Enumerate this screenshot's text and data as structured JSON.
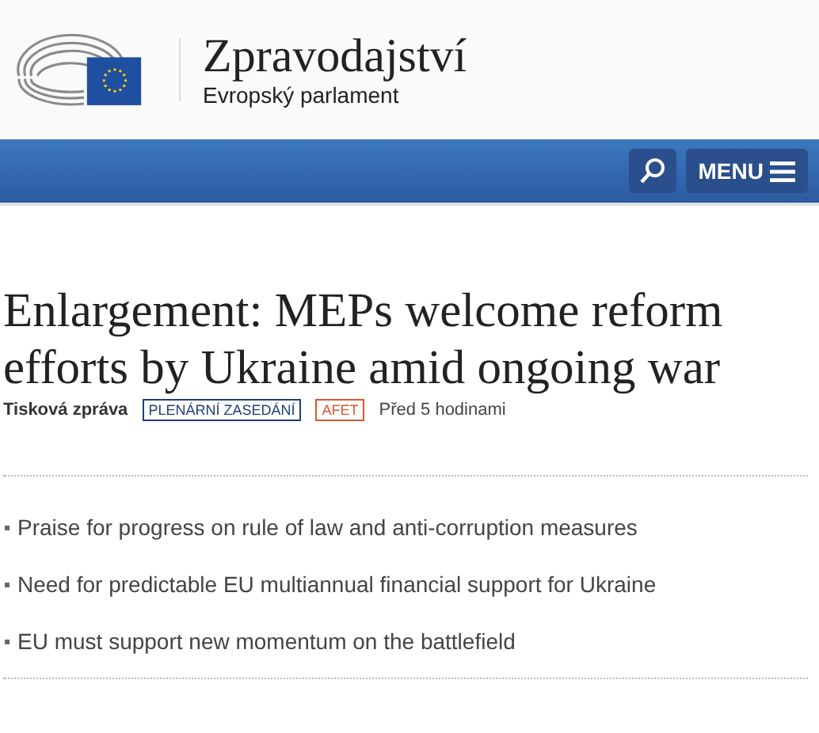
{
  "header": {
    "title": "Zpravodajství",
    "subtitle": "Evropský parlament"
  },
  "nav": {
    "menu_label": "MENU"
  },
  "article": {
    "title": "Enlargement: MEPs welcome reform efforts by Ukraine amid ongoing war",
    "type": "Tisková zpráva",
    "tags": [
      {
        "label": "PLENÁRNÍ ZASEDÁNÍ",
        "color": "#1f3f7a"
      },
      {
        "label": "AFET",
        "color": "#d9572c"
      }
    ],
    "time": "Před 5 hodinami",
    "highlights": [
      "Praise for progress on rule of law and anti-corruption measures",
      "Need for predictable EU multiannual financial support for Ukraine",
      "EU must support new momentum on the battlefield"
    ]
  }
}
